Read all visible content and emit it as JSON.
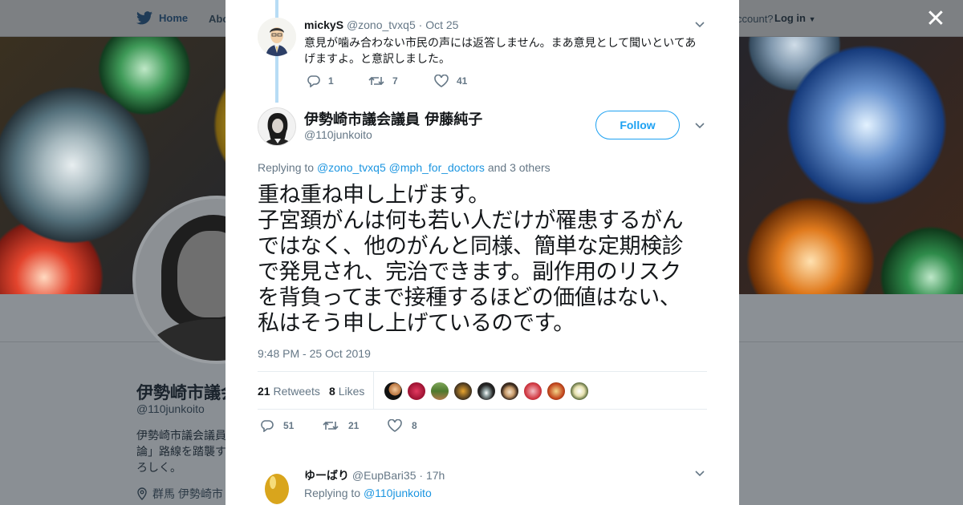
{
  "background": {
    "nav": {
      "home": "Home",
      "about": "Abo",
      "account": "ccount?",
      "login": "Log in"
    },
    "profile": {
      "name": "伊勢崎市議会議員",
      "handle": "@110junkoito",
      "bio_lines": [
        "伊勢崎市議会議員",
        "論」路線を踏襲す",
        "ろしく。"
      ],
      "location": "群馬 伊勢崎市"
    }
  },
  "modal": {
    "parent_tweet": {
      "name": "mickyS",
      "handle": "@zono_tvxq5",
      "date": "Oct 25",
      "text_lines": [
        "意見が噛み合わない市民の声には返答しません。まあ意見として聞いといてあ",
        "げますよ。と意訳しました。"
      ],
      "replies": "1",
      "retweets": "7",
      "likes": "41"
    },
    "main_tweet": {
      "name": "伊勢崎市議会議員 伊藤純子",
      "handle": "@110junkoito",
      "follow_label": "Follow",
      "replying_to_label": "Replying to",
      "replying_to_users": [
        "@zono_tvxq5",
        "@mph_for_doctors"
      ],
      "replying_to_more": "and 3 others",
      "text_lines": [
        "重ね重ね申し上げます。",
        "子宮頚がんは何も若い人だけが罹患するがん",
        "ではなく、他のがんと同様、簡単な定期検診",
        "で発見され、完治できます。副作用のリスク",
        "を背負ってまで接種するほどの価値はない、",
        "私はそう申し上げているのです。"
      ],
      "timestamp": "9:48 PM - 25 Oct 2019",
      "retweets_count": "21",
      "retweets_label": "Retweets",
      "likes_count": "8",
      "likes_label": "Likes",
      "replies": "51",
      "retweets": "21",
      "likes": "8"
    },
    "reply_tweet": {
      "name": "ゆーばり",
      "handle": "@EupBari35",
      "date": "17h",
      "replying_to_label": "Replying to",
      "replying_to_user": "@110junkoito"
    }
  },
  "colors": {
    "accent": "#1da1f2",
    "link": "#1b95e0",
    "thread_line": "#b7dcf5"
  }
}
